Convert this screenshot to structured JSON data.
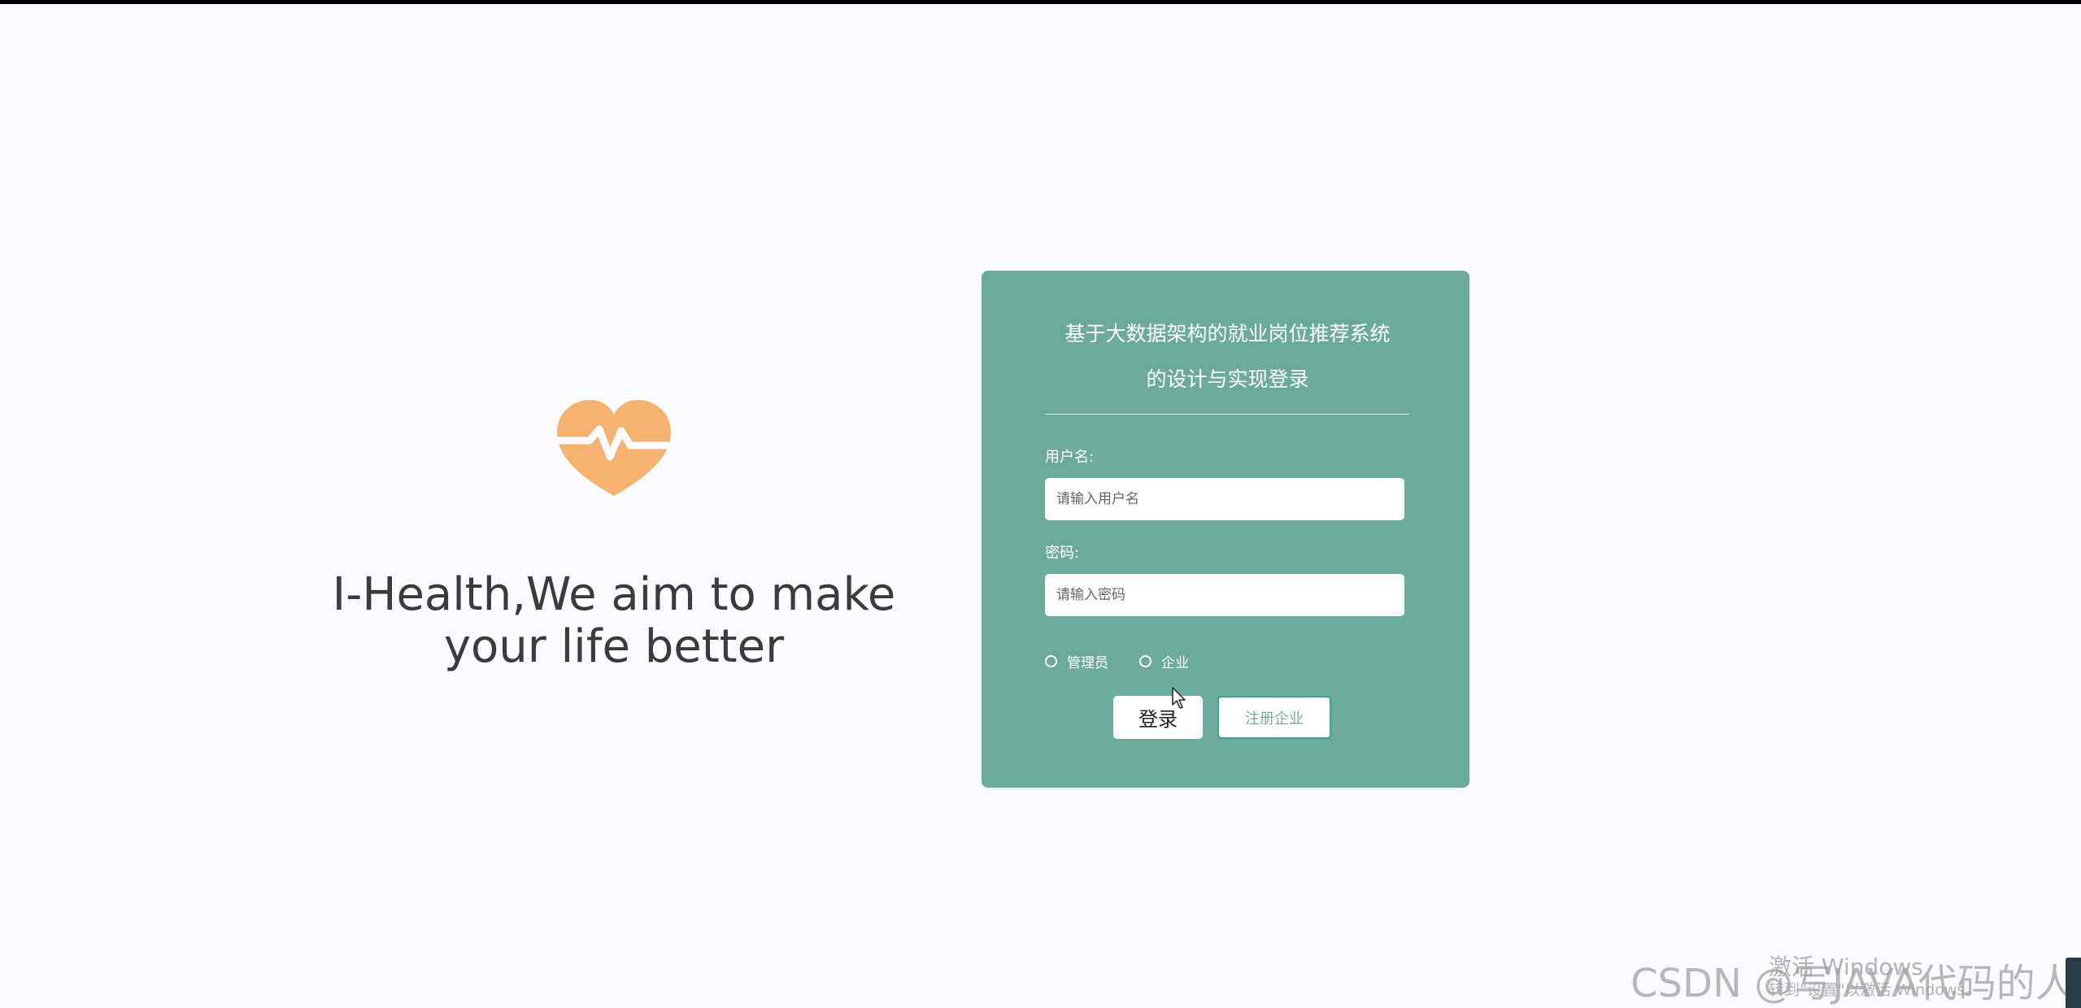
{
  "brand": {
    "slogan_line1": "I-Health,We aim to make",
    "slogan_line2": "your life better",
    "logo_icon": "heartbeat-heart-icon",
    "logo_color": "#f6b26f"
  },
  "login_card": {
    "title_line1": "基于大数据架构的就业岗位推荐系统",
    "title_line2": "的设计与实现登录",
    "background_color": "#6aab9b",
    "username": {
      "label": "用户名:",
      "value": "",
      "placeholder": "请输入用户名"
    },
    "password": {
      "label": "密码:",
      "value": "",
      "placeholder": "请输入密码"
    },
    "roles": [
      {
        "label": "管理员",
        "selected": false
      },
      {
        "label": "企业",
        "selected": false
      }
    ],
    "login_button": "登录",
    "register_button": "注册企业"
  },
  "watermarks": {
    "windows_activate": "激活 Windows",
    "windows_activate_sub": "转到\"设置\"以激活 Windows。",
    "csdn": "CSDN @写JAVA代码的人"
  }
}
